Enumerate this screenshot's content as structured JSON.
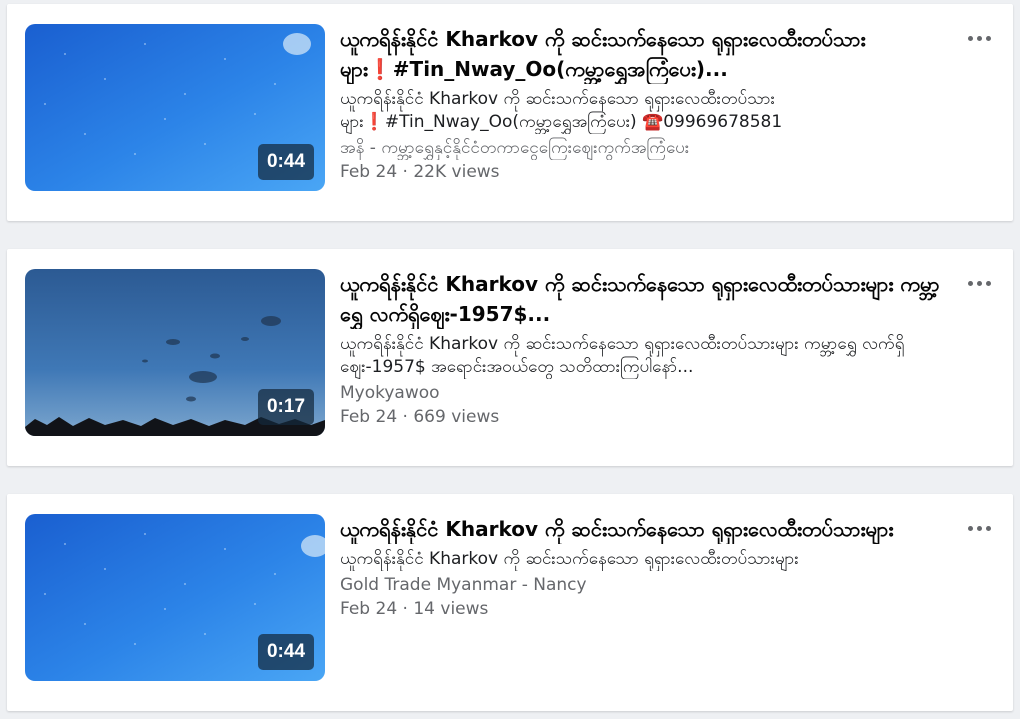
{
  "videos": [
    {
      "title_part1": "ယူကရိန်းနိုင်ငံ Kharkov ကို ဆင်းသက်နေသော ရုရှားလေထီးတပ်သားများ",
      "title_bang": "❗",
      "title_part2": "#Tin_Nway_Oo(ကမ္ဘာ့ရွှေအကြံပေး)...",
      "desc_part1": "ယူကရိန်းနိုင်ငံ Kharkov ကို ဆင်းသက်နေသော ရုရှားလေထီးတပ်သားများ",
      "desc_bang": "❗",
      "desc_part2": "#Tin_Nway_Oo(ကမ္ဘာ့ရွှေအကြံပေး) ☎️09969678581",
      "channel": "အနိ - ကမ္ဘာ့ရွှေနှင့်နိုင်ငံတကာငွေကြေးဈေးကွက်အကြံပေး",
      "meta": "Feb 24 · 22K views",
      "duration": "0:44",
      "thumb_style": "sky"
    },
    {
      "title_part1": "ယူကရိန်းနိုင်ငံ Kharkov ကို ဆင်းသက်နေသော ရုရှားလေထီးတပ်သားများ ကမ္ဘာ့ရွှေ လက်ရှိဈေး-1957$...",
      "title_bang": "",
      "title_part2": "",
      "desc_part1": "ယူကရိန်းနိုင်ငံ Kharkov ကို ဆင်းသက်နေသော ရုရှားလေထီးတပ်သားများ ကမ္ဘာ့ရွှေ လက်ရှိဈေး-1957$ အရောင်းအဝယ်တွေ သတိထားကြပါနော်...",
      "desc_bang": "",
      "desc_part2": "",
      "channel": "Myokyawoo",
      "meta": "Feb 24 · 669 views",
      "duration": "0:17",
      "thumb_style": "dusk"
    },
    {
      "title_part1": "ယူကရိန်းနိုင်ငံ Kharkov ကို ဆင်းသက်နေသော ရုရှားလေထီးတပ်သားများ",
      "title_bang": "",
      "title_part2": "",
      "desc_part1": "ယူကရိန်းနိုင်ငံ Kharkov ကို ဆင်းသက်နေသော ရုရှားလေထီးတပ်သားများ",
      "desc_bang": "",
      "desc_part2": "",
      "channel": "Gold Trade Myanmar - Nancy",
      "meta": "Feb 24 · 14 views",
      "duration": "0:44",
      "thumb_style": "sky"
    }
  ],
  "colors": {
    "title": "#050505",
    "secondary": "#65676b",
    "accent_bang": "#d42b2b"
  },
  "icons": {
    "more": "more-horizontal-icon"
  }
}
